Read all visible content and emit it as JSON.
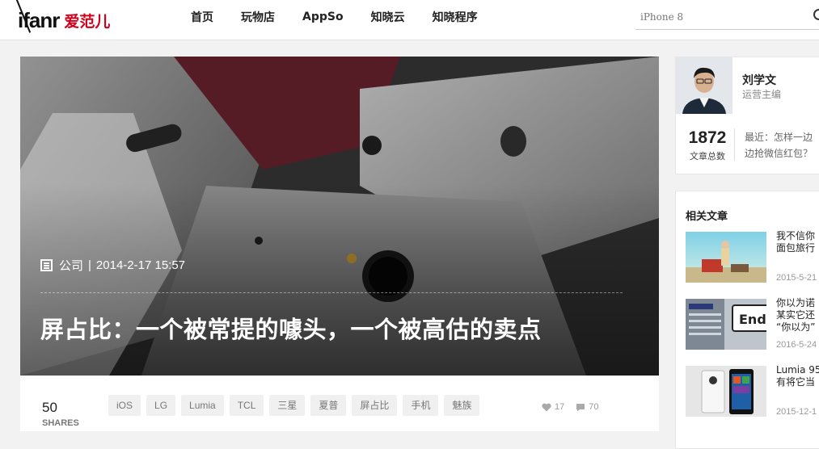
{
  "header": {
    "logo_en": "ifanr",
    "logo_cn": "爱范儿",
    "nav": [
      "首页",
      "玩物店",
      "AppSo",
      "知晓云",
      "知晓程序"
    ],
    "search_placeholder": "iPhone 8"
  },
  "hero": {
    "category": "公司",
    "separator": "|",
    "date": "2014-2-17 15:57",
    "title": "屏占比：一个被常提的噱头，一个被高估的卖点"
  },
  "article_bar": {
    "shares_count": "50",
    "shares_label": "SHARES",
    "tags": [
      "iOS",
      "LG",
      "Lumia",
      "TCL",
      "三星",
      "夏普",
      "屏占比",
      "手机",
      "魅族"
    ],
    "likes": "17",
    "comments": "70"
  },
  "author": {
    "name": "刘学文",
    "role": "运营主编",
    "article_count": "1872",
    "article_count_label": "文章总数",
    "latest_line1": "最近：怎样一边",
    "latest_line2": "边抢微信红包？"
  },
  "related": {
    "title": "相关文章",
    "items": [
      {
        "line1": "我不信你",
        "line2": "面包旅行",
        "date": "2015-5-21"
      },
      {
        "line1": "你以为诺",
        "line2": "某实它还",
        "line3": "“你以为”",
        "date": "2016-5-24"
      },
      {
        "line1": "Lumia 95",
        "line2": "有将它当",
        "date": "2015-12-1"
      }
    ]
  },
  "colors": {
    "brand_red": "#d0021b",
    "hero_overlay": "#3a3a3a",
    "tag_bg": "#f0f0f0"
  }
}
